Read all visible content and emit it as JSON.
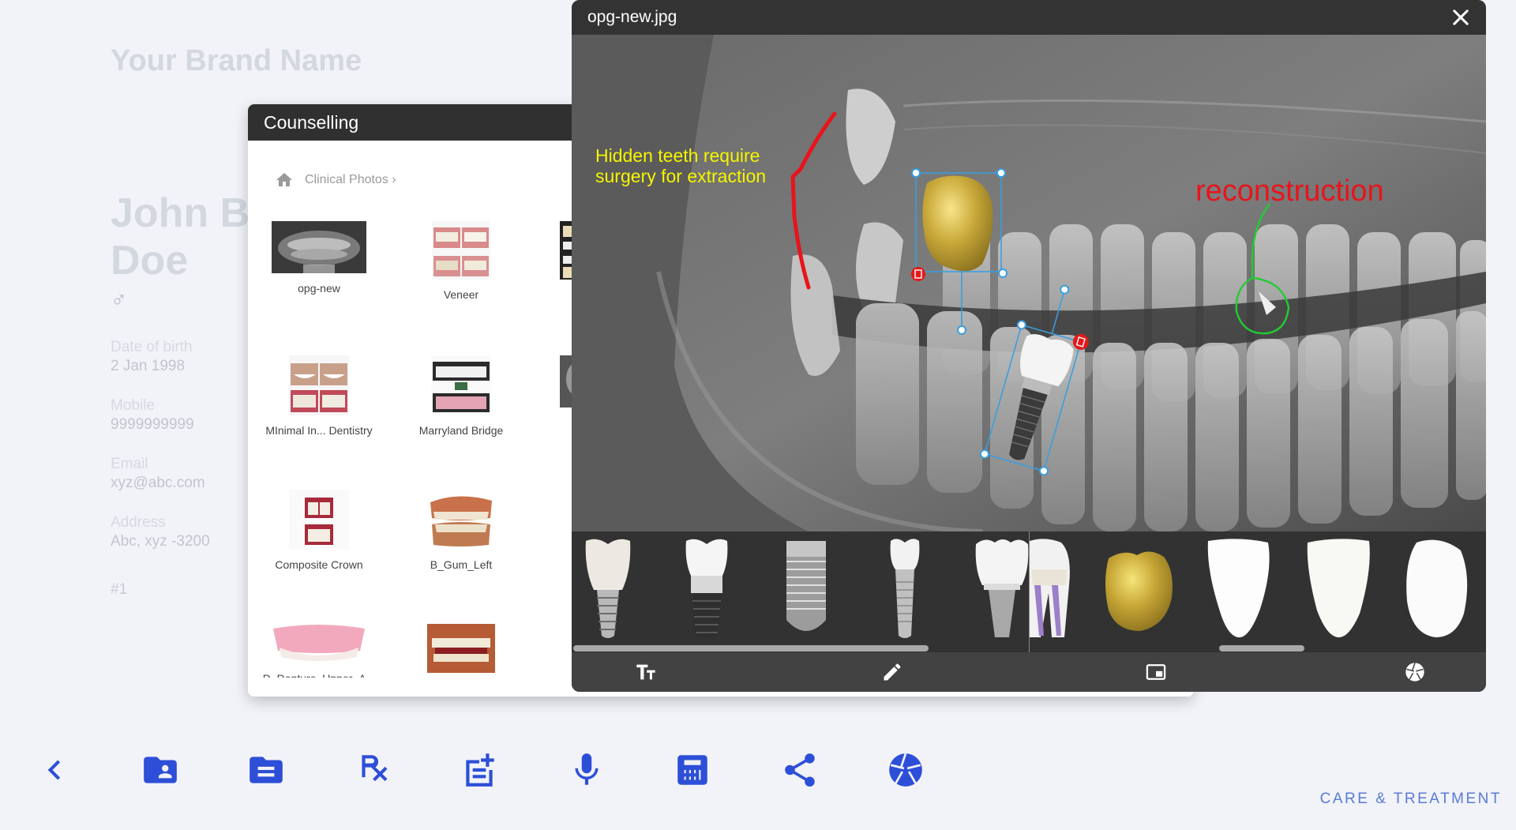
{
  "brand": {
    "name": "Your Brand Name"
  },
  "patient": {
    "first_name": "John B",
    "last_name": "Doe",
    "gender_symbol": "♂",
    "fields": [
      {
        "label": "Date of birth",
        "value": "2 Jan 1998"
      },
      {
        "label": "Mobile",
        "value": "9999999999"
      },
      {
        "label": "Email",
        "value": "xyz@abc.com"
      },
      {
        "label": "Address",
        "value": "Abc, xyz -3200"
      }
    ],
    "record_number": "#1"
  },
  "counselling": {
    "title": "Counselling",
    "breadcrumb": {
      "home_icon": "home-icon",
      "folder": "Clinical Photos",
      "separator": "›"
    },
    "tiles": [
      {
        "label": "opg-new",
        "kind": "xray"
      },
      {
        "label": "Veneer",
        "kind": "veneer"
      },
      {
        "label": "MInimal In... Dentistry",
        "kind": "smile"
      },
      {
        "label": "Marryland Bridge",
        "kind": "bridge"
      },
      {
        "label": "Composite Crown",
        "kind": "composite"
      },
      {
        "label": "B_Gum_Left",
        "kind": "gum"
      },
      {
        "label": "D_Denture_Upper_A...",
        "kind": "denture"
      },
      {
        "label": "",
        "kind": "mouth"
      }
    ]
  },
  "viewer": {
    "title": "opg-new.jpg",
    "close_icon": "close-icon",
    "annotations": {
      "note_1": "Hidden teeth require",
      "note_2": "surgery for extraction",
      "note_3": "reconstruction",
      "note_colors": {
        "yellow": "#f5f500",
        "red": "#e8141b",
        "green": "#22cc33",
        "selection": "#3a9ee0"
      }
    },
    "strip_items": [
      "implant-crown-icon",
      "implant-abutment-icon",
      "implant-screw-icon",
      "mini-implant-icon",
      "molar-implant-icon",
      "root-canal-tooth-icon",
      "gold-crown-icon",
      "veneer-icon",
      "veneer-icon",
      "veneer-icon"
    ],
    "toolbar": [
      {
        "name": "text-tool",
        "icon": "text-size-icon"
      },
      {
        "name": "draw-tool",
        "icon": "pencil-icon"
      },
      {
        "name": "picture-in-picture-tool",
        "icon": "picture-in-picture-icon"
      },
      {
        "name": "capture-tool",
        "icon": "camera-shutter-icon"
      }
    ]
  },
  "bottom_nav": [
    {
      "name": "back",
      "icon": "chevron-left-icon"
    },
    {
      "name": "patient-folder",
      "icon": "folder-account-icon"
    },
    {
      "name": "documents-folder",
      "icon": "folder-document-icon"
    },
    {
      "name": "prescription",
      "icon": "rx-icon"
    },
    {
      "name": "add-note",
      "icon": "note-add-icon"
    },
    {
      "name": "voice",
      "icon": "microphone-icon"
    },
    {
      "name": "calculator",
      "icon": "calculator-icon"
    },
    {
      "name": "share",
      "icon": "share-icon"
    },
    {
      "name": "capture",
      "icon": "camera-shutter-icon"
    }
  ],
  "footer": {
    "section_label": "CARE & TREATMENT"
  },
  "colors": {
    "accent": "#2d4fd8",
    "section_label": "#5b7ad6",
    "panel_header": "#303030"
  }
}
